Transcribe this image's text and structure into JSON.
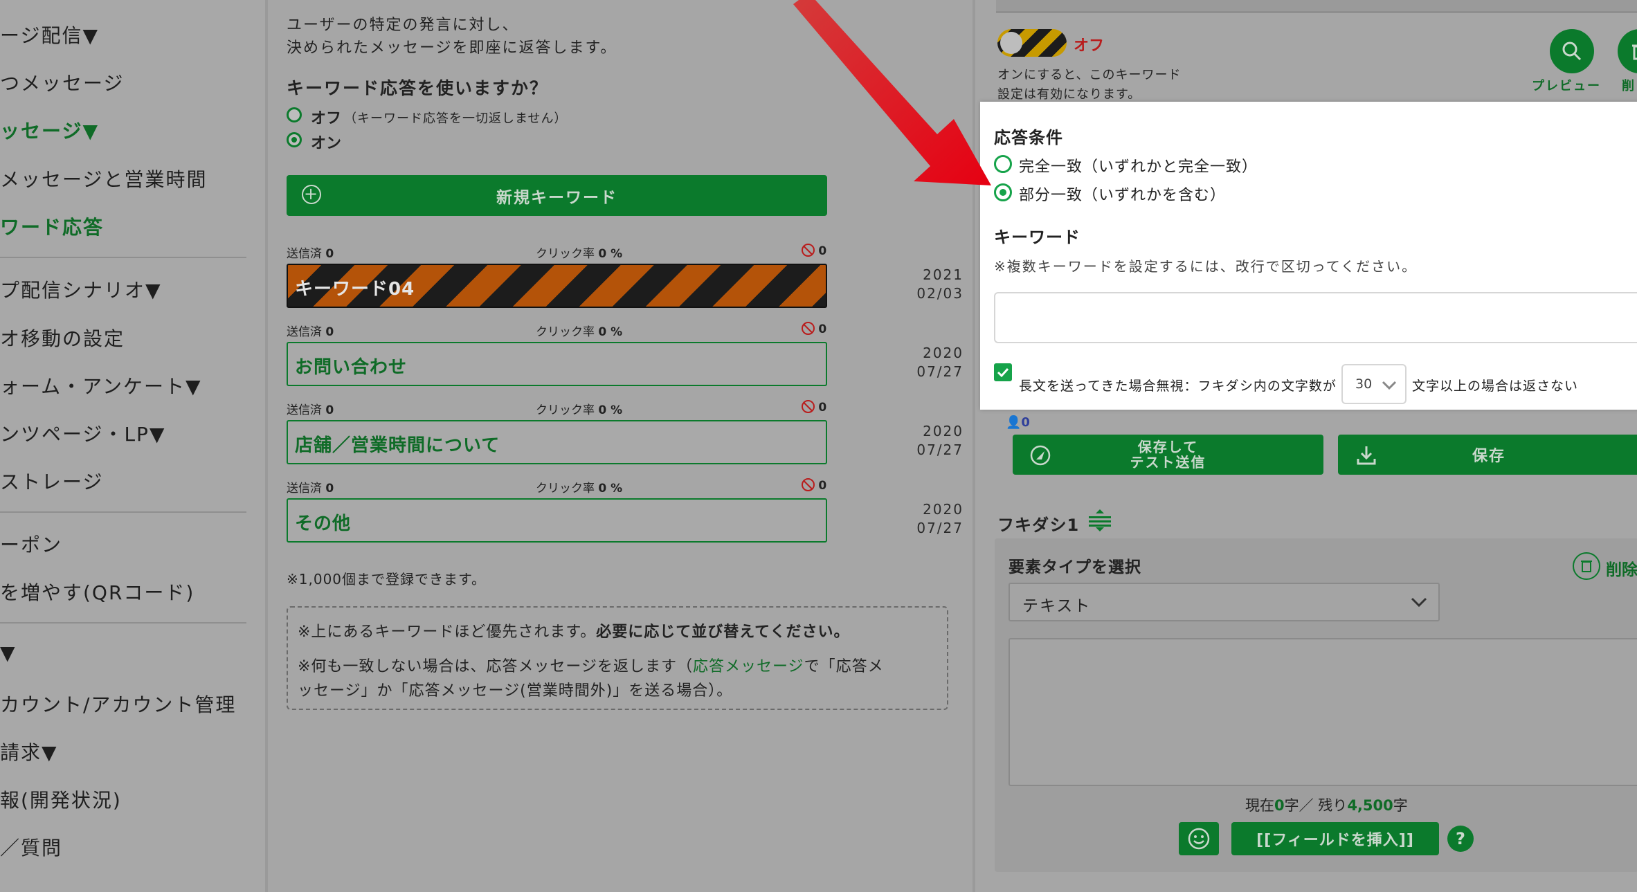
{
  "sidebar": {
    "items": [
      {
        "label": "ージ配信▼",
        "active": false
      },
      {
        "label": "つメッセージ",
        "active": false
      },
      {
        "label": "ッセージ▼",
        "active": true
      },
      {
        "label": "メッセージと営業時間",
        "active": false
      },
      {
        "label": "ワード応答",
        "active": true
      },
      {
        "label": "プ配信シナリオ▼",
        "active": false
      },
      {
        "label": "オ移動の設定",
        "active": false
      },
      {
        "label": "ォーム・アンケート▼",
        "active": false
      },
      {
        "label": "ンツページ・LP▼",
        "active": false
      },
      {
        "label": "ストレージ",
        "active": false
      },
      {
        "label": "ーポン",
        "active": false
      },
      {
        "label": "を増やす(QRコード)",
        "active": false
      },
      {
        "label": "▼",
        "active": false
      },
      {
        "label": "カウント/アカウント管理",
        "active": false
      },
      {
        "label": "請求▼",
        "active": false
      },
      {
        "label": "報(開発状況)",
        "active": false
      },
      {
        "label": "／質問",
        "active": false
      }
    ]
  },
  "middle": {
    "intro_line1": "ユーザーの特定の発言に対し、",
    "intro_line2": "決められたメッセージを即座に返答します。",
    "question": "キーワード応答を使いますか？",
    "option_off_label": "オフ",
    "option_off_note": "（キーワード応答を一切返しません）",
    "option_on_label": "オン",
    "new_keyword_button": "新規キーワード",
    "stat_sent_label": "送信済",
    "stat_click_label": "クリック率",
    "keywords": [
      {
        "name": "キーワード04",
        "sent": "0",
        "click": "0 %",
        "blocked": "0",
        "year": "2021",
        "date": "02/03"
      },
      {
        "name": "お問い合わせ",
        "sent": "0",
        "click": "0 %",
        "blocked": "0",
        "year": "2020",
        "date": "07/27"
      },
      {
        "name": "店舗／営業時間について",
        "sent": "0",
        "click": "0 %",
        "blocked": "0",
        "year": "2020",
        "date": "07/27"
      },
      {
        "name": "その他",
        "sent": "0",
        "click": "0 %",
        "blocked": "0",
        "year": "2020",
        "date": "07/27"
      }
    ],
    "limit_note": "※1,000個まで登録できます。",
    "note_line1_a": "※上にあるキーワードほど優先されます。",
    "note_line1_b": "必要に応じて並び替えてください。",
    "note_line2_a": "※何も一致しない場合は、応答メッセージを返します（",
    "note_line2_link": "応答メッセージ",
    "note_line2_b": "で「応答メ",
    "note_line3": "ッセージ」か「応答メッセージ(営業時間外)」を送る場合）。"
  },
  "right": {
    "toggle_state": "オフ",
    "toggle_note_line1": "オンにすると、このキーワード",
    "toggle_note_line2": "設定は有効になります。",
    "preview_label": "プレビュー",
    "delete_label_top": "削",
    "popup": {
      "condition_title": "応答条件",
      "exact_match": "完全一致（いずれかと完全一致）",
      "partial_match": "部分一致（いずれかを含む）",
      "keyword_title": "キーワード",
      "keyword_hint": "※複数キーワードを設定するには、改行で区切ってください。",
      "keyword_value": "",
      "long_text_label": "長文を送ってきた場合無視：フキダシ内の文字数が",
      "long_text_value": "30",
      "long_text_suffix": "文字以上の場合は返さない"
    },
    "user_count": "0",
    "save_test_line1": "保存して",
    "save_test_line2": "テスト送信",
    "save_label": "保存",
    "bubble_title": "フキダシ1",
    "element_type_label": "要素タイプを選択",
    "element_delete": "削除",
    "element_type_value": "テキスト",
    "text_value": "",
    "counter_prefix": "現在",
    "counter_current": "0",
    "counter_mid": "字／ 残り",
    "counter_remaining": "4,500",
    "counter_suffix": "字",
    "insert_field_button": "[[フィールドを挿入]]",
    "help_label": "?"
  },
  "colors": {
    "brand_green": "#0b7a2c",
    "active_green": "#16a34a",
    "warning_red": "#dc2626",
    "stripe_orange": "#b45309"
  }
}
